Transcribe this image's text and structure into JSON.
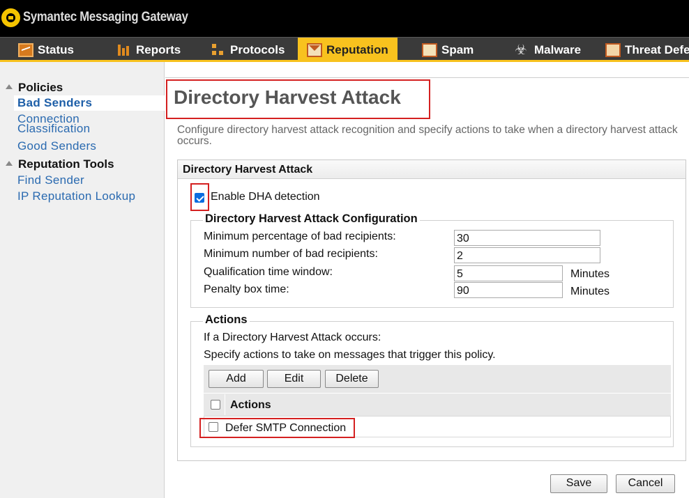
{
  "app": {
    "title": "Symantec Messaging Gateway"
  },
  "tabs": [
    {
      "label": "Status",
      "icon": "status-icon"
    },
    {
      "label": "Reports",
      "icon": "reports-icon"
    },
    {
      "label": "Protocols",
      "icon": "protocols-icon"
    },
    {
      "label": "Reputation",
      "icon": "reputation-icon",
      "active": true
    },
    {
      "label": "Spam",
      "icon": "spam-icon"
    },
    {
      "label": "Malware",
      "icon": "malware-icon"
    },
    {
      "label": "Threat Defe",
      "icon": "threat-defense-icon"
    }
  ],
  "sidebar": {
    "policies_label": "Policies",
    "policies": [
      {
        "label": "Bad Senders",
        "selected": true
      },
      {
        "label": "Connection Classification"
      },
      {
        "label": "Good Senders"
      }
    ],
    "tools_label": "Reputation Tools",
    "tools": [
      {
        "label": "Find Sender"
      },
      {
        "label": "IP Reputation Lookup"
      }
    ]
  },
  "main": {
    "title": "Directory Harvest Attack",
    "description": "Configure directory harvest attack recognition and specify actions to take when a directory harvest attack occurs.",
    "panel_title": "Directory Harvest Attack",
    "enable_label": "Enable DHA detection",
    "enable_checked": true,
    "config": {
      "legend": "Directory Harvest Attack Configuration",
      "rows": [
        {
          "label": "Minimum percentage of bad recipients:",
          "value": "30",
          "unit": ""
        },
        {
          "label": "Minimum number of bad recipients:",
          "value": "2",
          "unit": ""
        },
        {
          "label": "Qualification time window:",
          "value": "5",
          "unit": "Minutes"
        },
        {
          "label": "Penalty box time:",
          "value": "90",
          "unit": "Minutes"
        }
      ]
    },
    "actions": {
      "legend": "Actions",
      "line1": "If a Directory Harvest Attack occurs:",
      "line2": "Specify actions to take on messages that trigger this policy.",
      "add": "Add",
      "edit": "Edit",
      "delete": "Delete",
      "column_header": "Actions",
      "rows": [
        {
          "label": "Defer SMTP Connection",
          "checked": false
        }
      ]
    },
    "save": "Save",
    "cancel": "Cancel"
  },
  "colors": {
    "accent": "#f8c21e",
    "link": "#2a6ab0",
    "highlight": "#d42020"
  }
}
